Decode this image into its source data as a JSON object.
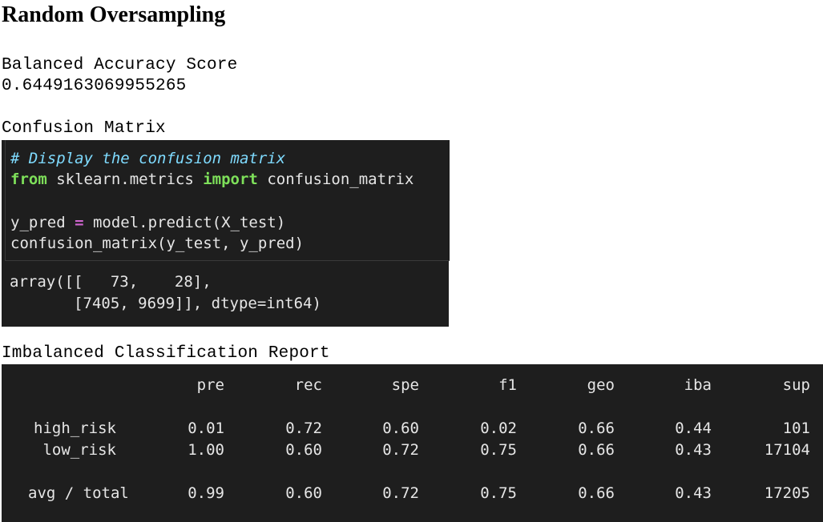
{
  "title": "Random Oversampling",
  "balanced_accuracy": {
    "label": "Balanced Accuracy Score",
    "value": "0.6449163069955265"
  },
  "confusion": {
    "label": "Confusion Matrix",
    "code": {
      "comment": "# Display the confusion matrix",
      "kw_from": "from",
      "module": " sklearn.metrics ",
      "kw_import": "import",
      "import_name": " confusion_matrix",
      "assign_lhs": "y_pred ",
      "assign_op": "=",
      "assign_rhs": " model.predict(X_test)",
      "call": "confusion_matrix(y_test, y_pred)"
    },
    "output": {
      "line1": "array([[   73,    28],",
      "line2": "       [7405, 9699]], dtype=int64)"
    }
  },
  "report": {
    "label": "Imbalanced Classification Report",
    "columns": [
      "pre",
      "rec",
      "spe",
      "f1",
      "geo",
      "iba",
      "sup"
    ],
    "rows": [
      {
        "label": "high_risk",
        "values": [
          "0.01",
          "0.72",
          "0.60",
          "0.02",
          "0.66",
          "0.44",
          "101"
        ]
      },
      {
        "label": "low_risk",
        "values": [
          "1.00",
          "0.60",
          "0.72",
          "0.75",
          "0.66",
          "0.43",
          "17104"
        ]
      },
      {
        "label": "avg / total",
        "values": [
          "0.99",
          "0.60",
          "0.72",
          "0.75",
          "0.66",
          "0.43",
          "17205"
        ]
      }
    ]
  }
}
